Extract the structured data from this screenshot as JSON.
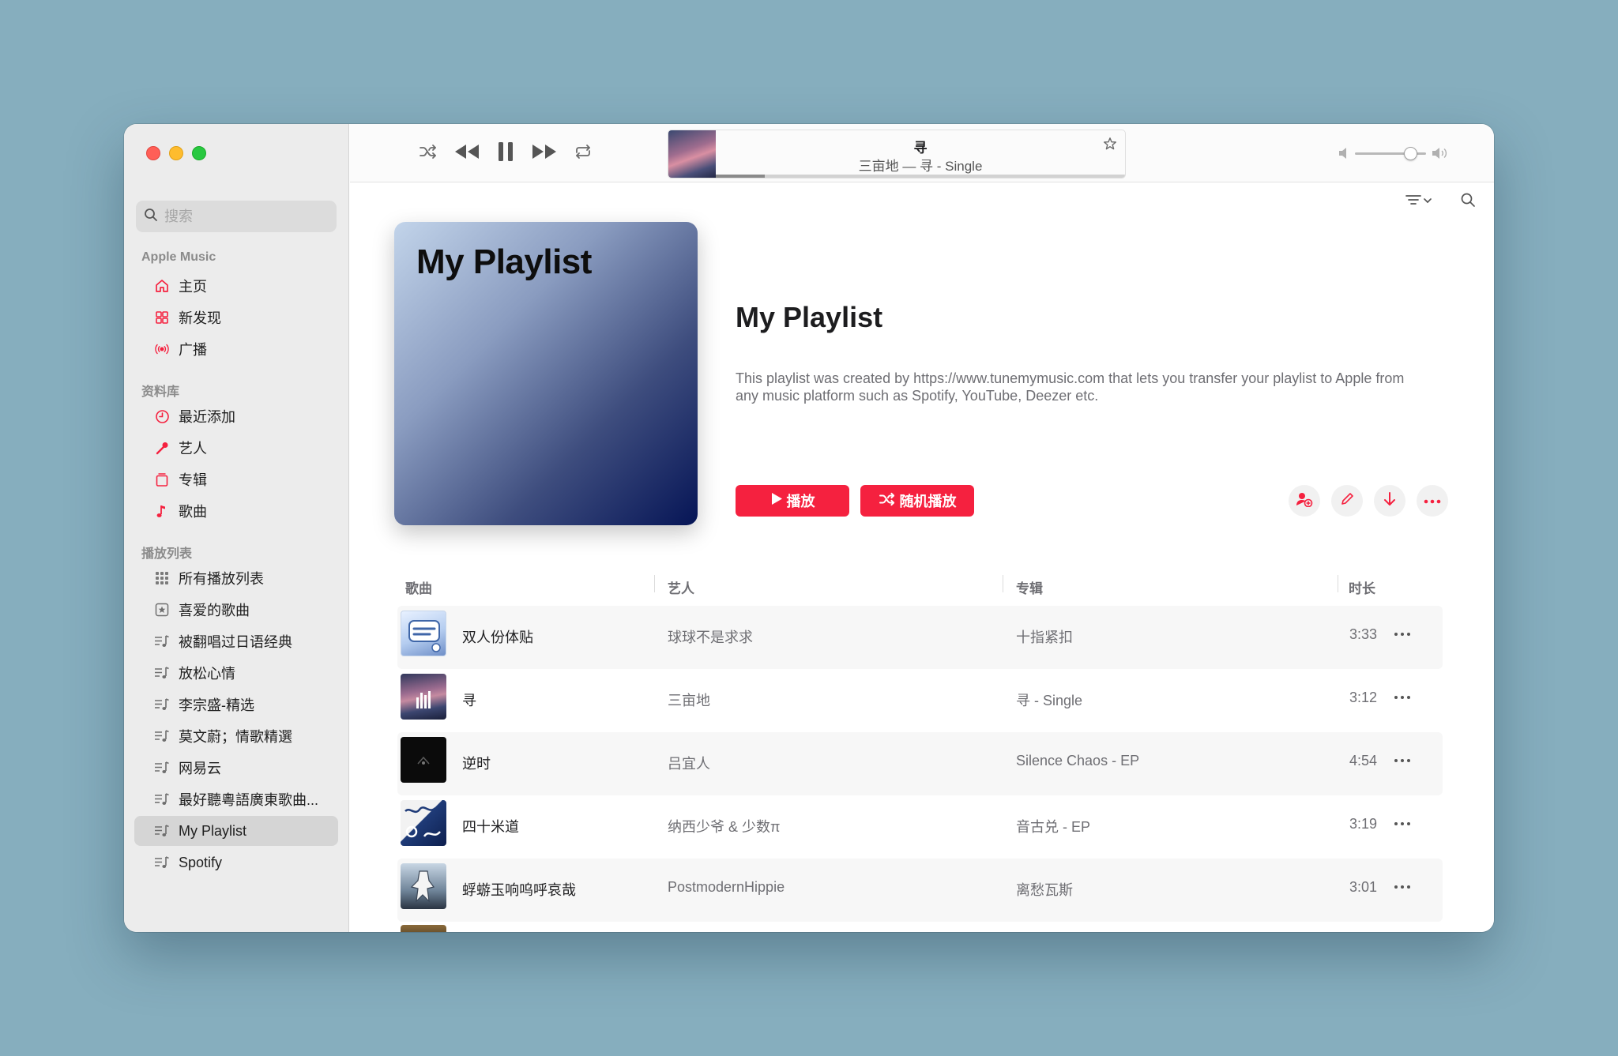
{
  "sidebar": {
    "search_placeholder": "搜索",
    "sections": {
      "apple_music": "Apple Music",
      "library": "资料库",
      "playlists": "播放列表"
    },
    "apple_music_items": [
      {
        "label": "主页",
        "icon": "home-icon"
      },
      {
        "label": "新发现",
        "icon": "grid-icon"
      },
      {
        "label": "广播",
        "icon": "broadcast-icon"
      }
    ],
    "library_items": [
      {
        "label": "最近添加",
        "icon": "clock-icon"
      },
      {
        "label": "艺人",
        "icon": "microphone-icon"
      },
      {
        "label": "专辑",
        "icon": "album-icon"
      },
      {
        "label": "歌曲",
        "icon": "music-note-icon"
      }
    ],
    "playlist_items": [
      {
        "label": "所有播放列表",
        "icon": "grid-icon"
      },
      {
        "label": "喜爱的歌曲",
        "icon": "star-box-icon"
      },
      {
        "label": "被翻唱过日语经典",
        "icon": "playlist-icon"
      },
      {
        "label": "放松心情",
        "icon": "playlist-icon"
      },
      {
        "label": "李宗盛-精选",
        "icon": "playlist-icon"
      },
      {
        "label": "莫文蔚；情歌精選",
        "icon": "playlist-icon"
      },
      {
        "label": "网易云",
        "icon": "playlist-icon"
      },
      {
        "label": "最好聽粵語廣東歌曲...",
        "icon": "playlist-icon"
      },
      {
        "label": "My Playlist",
        "icon": "playlist-icon",
        "active": true
      },
      {
        "label": "Spotify",
        "icon": "playlist-icon"
      }
    ]
  },
  "now_playing": {
    "title": "寻",
    "subtitle": "三亩地 — 寻 - Single",
    "progress": 0.12,
    "volume": 0.78
  },
  "playlist": {
    "cover_title": "My Playlist",
    "title": "My Playlist",
    "description": "This playlist was created by https://www.tunemymusic.com that lets you transfer your playlist to Apple from any music platform such as Spotify, YouTube, Deezer etc.",
    "play_label": "播放",
    "shuffle_label": "随机播放"
  },
  "table": {
    "headers": {
      "song": "歌曲",
      "artist": "艺人",
      "album": "专辑",
      "duration": "时长"
    },
    "rows": [
      {
        "song": "双人份体贴",
        "artist": "球球不是求求",
        "album": "十指紧扣",
        "duration": "3:33"
      },
      {
        "song": "寻",
        "artist": "三亩地",
        "album": "寻 - Single",
        "duration": "3:12"
      },
      {
        "song": "逆时",
        "artist": "吕宜人",
        "album": "Silence Chaos - EP",
        "duration": "4:54"
      },
      {
        "song": "四十米道",
        "artist": "纳西少爷 & 少数π",
        "album": "音古兑 - EP",
        "duration": "3:19"
      },
      {
        "song": "蜉蝣玉响呜呼哀哉",
        "artist": "PostmodernHippie",
        "album": "离愁瓦斯",
        "duration": "3:01"
      }
    ]
  },
  "colors": {
    "accent": "#f5213f",
    "sidebar_bg": "#ececec",
    "desktop_bg": "#86aebe"
  }
}
